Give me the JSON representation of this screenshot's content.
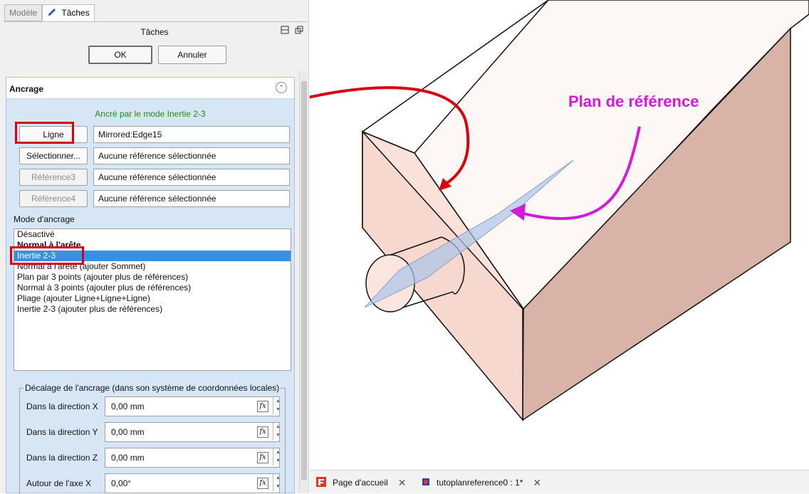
{
  "tabs": {
    "model": "Modèle",
    "tasks": "Tâches"
  },
  "task_header": {
    "title": "Tâches",
    "ok": "OK",
    "cancel": "Annuler"
  },
  "panel": {
    "title": "Ancrage",
    "status": "Ancré par le mode Inertie 2-3",
    "refs": [
      {
        "button": "Ligne",
        "value": "Mirrored:Edge15",
        "enabled": true
      },
      {
        "button": "Sélectionner...",
        "value": "Aucune référence sélectionnée",
        "enabled": true
      },
      {
        "button": "Référence3",
        "value": "Aucune référence sélectionnée",
        "enabled": false
      },
      {
        "button": "Référence4",
        "value": "Aucune référence sélectionnée",
        "enabled": false
      }
    ],
    "mode_label": "Mode d'ancrage",
    "modes": [
      "Désactivé",
      "Normal à l'arête",
      "Inertie 2-3",
      "Normal à l'arête (ajouter Sommet)",
      "Plan par 3 points (ajouter plus de références)",
      "Normal à 3 points (ajouter plus de références)",
      "Pliage (ajouter Ligne+Ligne+Ligne)",
      "Inertie 2-3 (ajouter plus de références)"
    ],
    "offset_group": "Décalage de l'ancrage (dans son système de coordonnées locales)",
    "offsets": [
      {
        "label": "Dans la direction X",
        "value": "0,00 mm"
      },
      {
        "label": "Dans la direction Y",
        "value": "0,00 mm"
      },
      {
        "label": "Dans la direction Z",
        "value": "0,00 mm"
      },
      {
        "label": "Autour de l'axe X",
        "value": "0,00°"
      }
    ]
  },
  "annotation": "Plan de référence",
  "bottom_tabs": [
    {
      "label": "Page d'accueil"
    },
    {
      "label": "tutoplanreference0 : 1*"
    }
  ],
  "colors": {
    "accent_red": "#d6000f",
    "annotation_magenta": "#d01cd8",
    "selection_blue": "#3b8fe3",
    "solid_face": "#f5d9cf"
  }
}
